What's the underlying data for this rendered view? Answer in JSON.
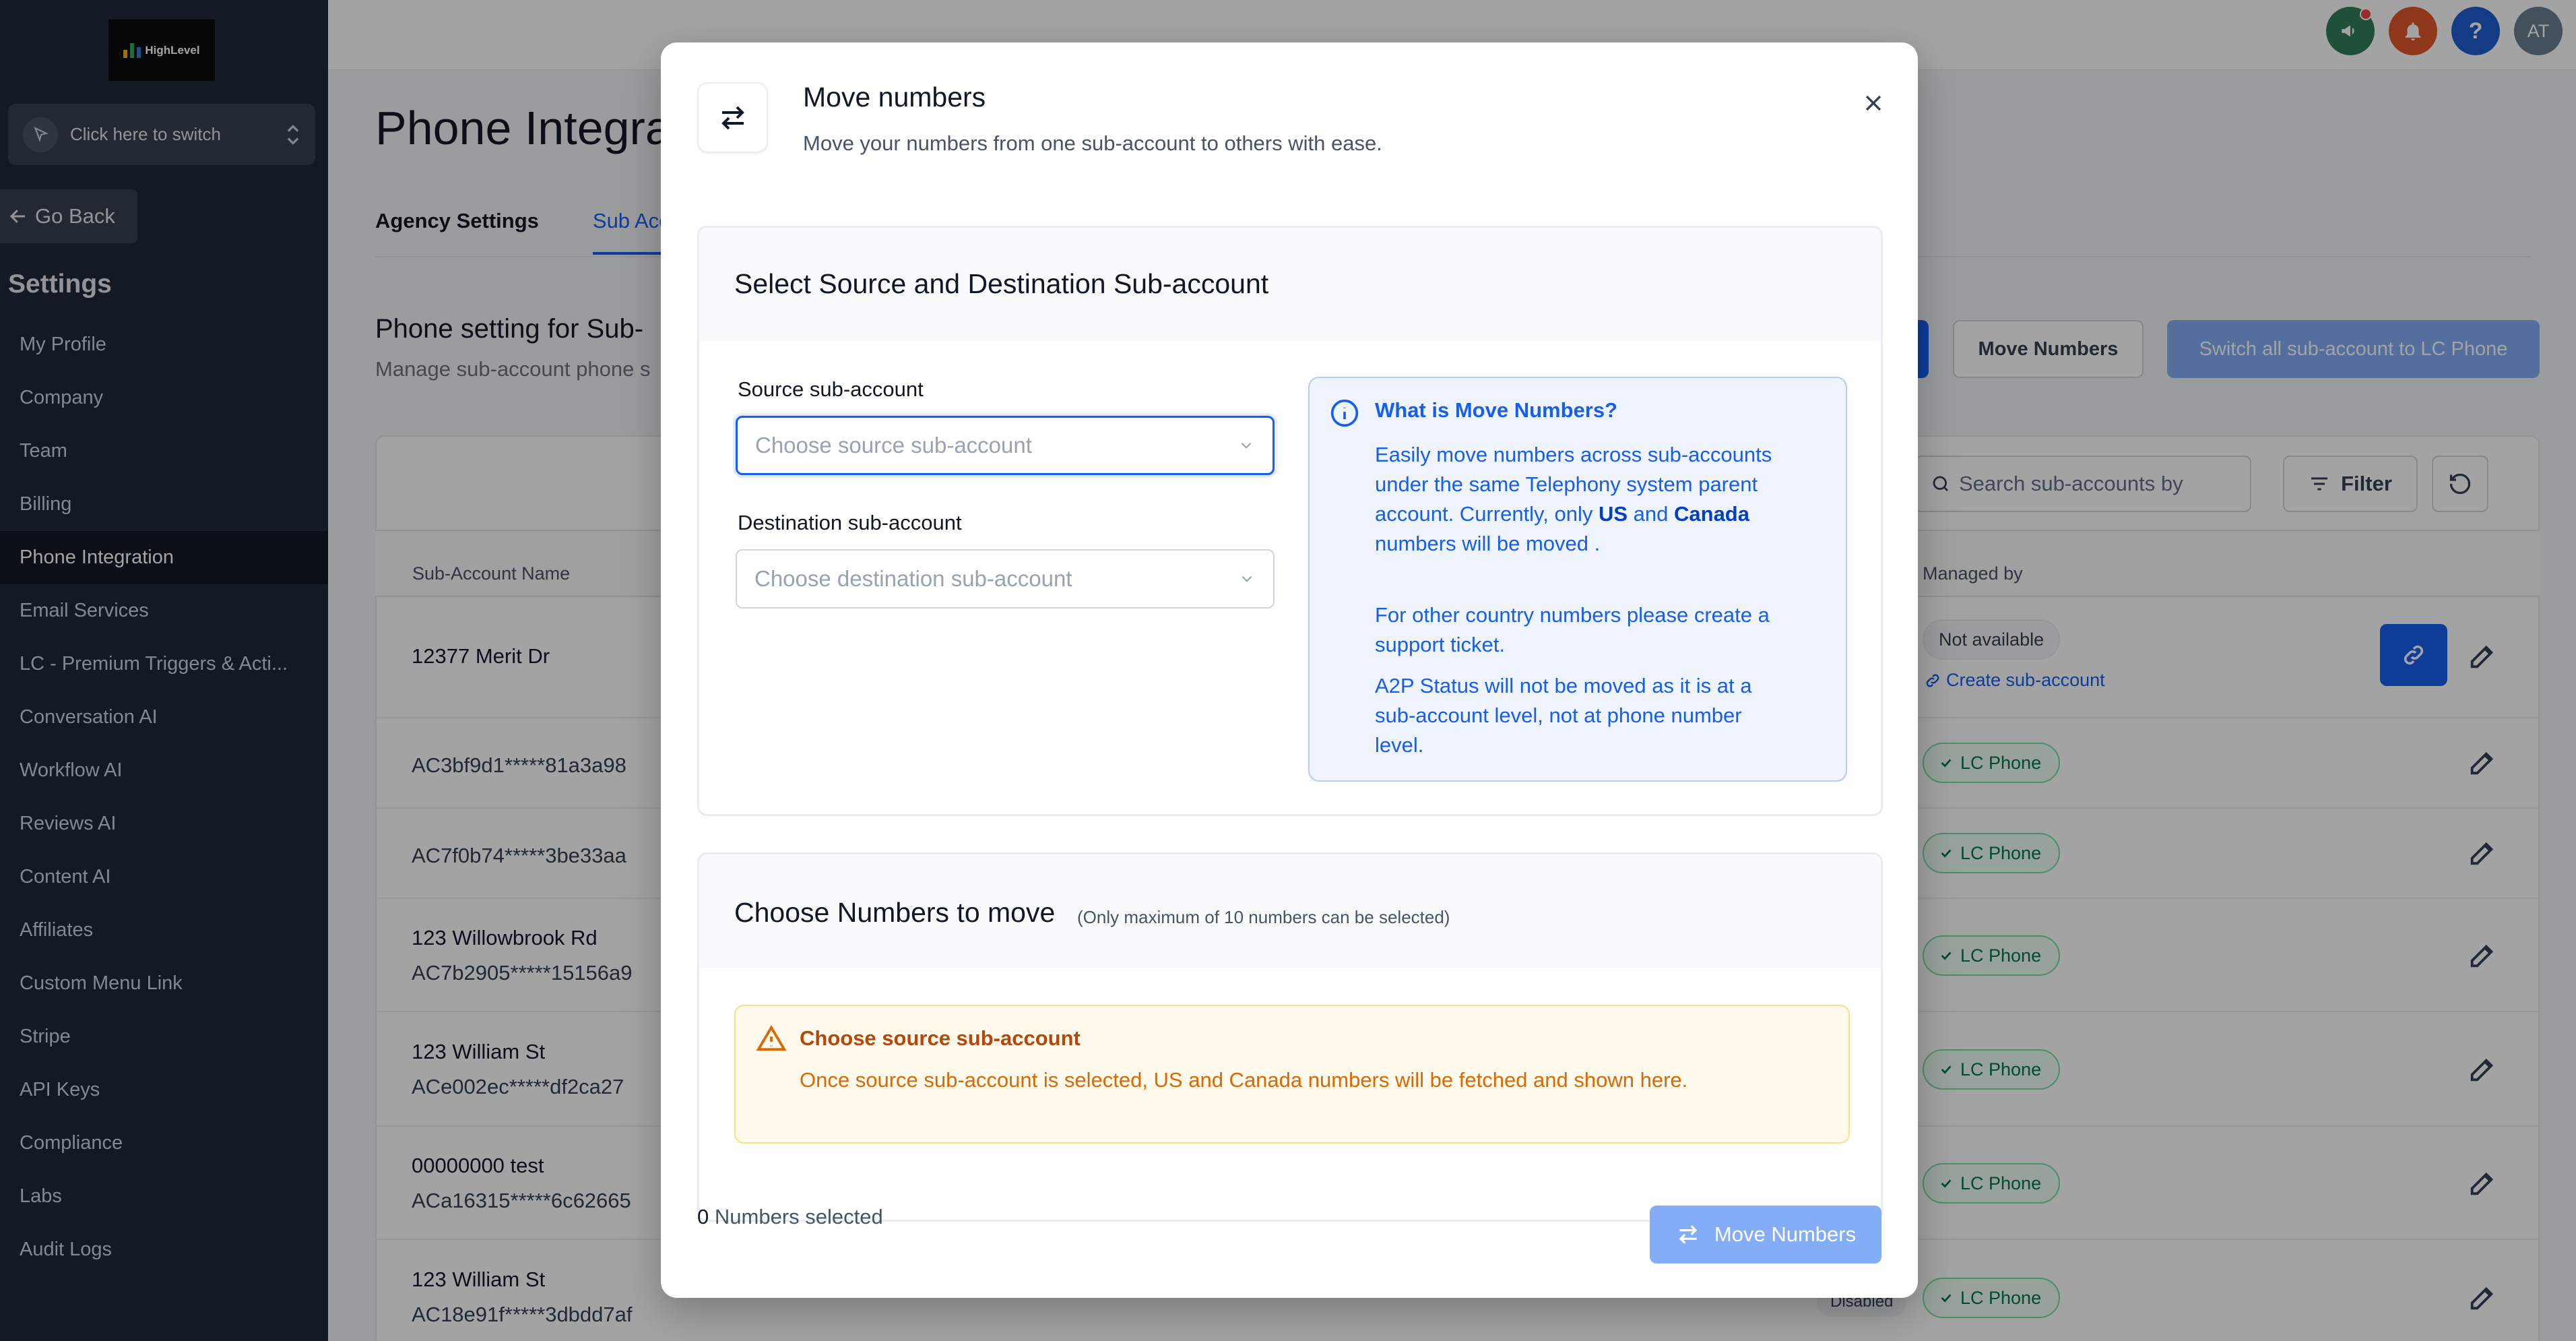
{
  "sidebar": {
    "logo_text": "HighLevel",
    "switcher_label": "Click here to switch",
    "go_back": "Go Back",
    "settings_title": "Settings",
    "items": [
      {
        "label": "My Profile"
      },
      {
        "label": "Company"
      },
      {
        "label": "Team"
      },
      {
        "label": "Billing"
      },
      {
        "label": "Phone Integration",
        "active": true
      },
      {
        "label": "Email Services"
      },
      {
        "label": "LC - Premium Triggers & Acti..."
      },
      {
        "label": "Conversation AI"
      },
      {
        "label": "Workflow AI"
      },
      {
        "label": "Reviews AI"
      },
      {
        "label": "Content AI"
      },
      {
        "label": "Affiliates"
      },
      {
        "label": "Custom Menu Link"
      },
      {
        "label": "Stripe"
      },
      {
        "label": "API Keys"
      },
      {
        "label": "Compliance"
      },
      {
        "label": "Labs"
      },
      {
        "label": "Audit Logs"
      }
    ]
  },
  "topbar": {
    "avatar_initials": "AT",
    "help_glyph": "?",
    "colors": {
      "announce": "#2f7d5b",
      "bell": "#e0562b",
      "help": "#1f5fd1",
      "avatar": "#6b7d8f"
    }
  },
  "page": {
    "title": "Phone Integra",
    "tabs": [
      "Agency Settings",
      "Sub Acc"
    ],
    "section_title": "Phone setting for Sub-",
    "section_sub": "Manage sub-account phone s",
    "move_numbers_btn": "Move Numbers",
    "switch_all_btn": "Switch all sub-account to LC Phone",
    "search_placeholder": "Search sub-accounts by",
    "filter_label": "Filter",
    "col_name": "Sub-Account Name",
    "col_managed": "Managed by",
    "rows": [
      {
        "name": "12377 Merit Dr",
        "sid": "",
        "managed": "Not available",
        "link": "Create sub-account"
      },
      {
        "name": "",
        "sid": "AC3bf9d1*****81a3a98",
        "managed": "LC Phone"
      },
      {
        "name": "",
        "sid": "AC7f0b74*****3be33aa",
        "managed": "LC Phone"
      },
      {
        "name": "123 Willowbrook Rd",
        "sid": "AC7b2905*****15156a9",
        "managed": "LC Phone"
      },
      {
        "name": "123 William St",
        "sid": "ACe002ec*****df2ca27",
        "managed": "LC Phone"
      },
      {
        "name": "00000000 test",
        "sid": "ACa16315*****6c62665",
        "managed": "LC Phone"
      },
      {
        "name": "123 William St",
        "sid": "AC18e91f*****3dbdd7af",
        "managed": "LC Phone",
        "status": "Disabled"
      }
    ]
  },
  "modal": {
    "title": "Move numbers",
    "subtitle": "Move your numbers from one sub-account to others with ease.",
    "section1_title": "Select Source and Destination Sub-account",
    "source_label": "Source sub-account",
    "source_placeholder": "Choose source sub-account",
    "dest_label": "Destination sub-account",
    "dest_placeholder": "Choose destination sub-account",
    "info": {
      "title": "What is Move Numbers?",
      "p1_a": "Easily move numbers across sub-accounts under the same Telephony system parent account. Currently, only ",
      "p1_us": "US",
      "p1_and": " and ",
      "p1_ca": "Canada",
      "p1_b": " numbers will be moved .",
      "p2": "For other country numbers please create a support ticket.",
      "p3": "A2P Status will not be moved as it is at a sub-account level, not at phone number level."
    },
    "section2_title": "Choose Numbers to move",
    "section2_note": "(Only maximum of 10 numbers can be selected)",
    "warning_title": "Choose source sub-account",
    "warning_text": "Once source sub-account is selected, US and Canada numbers will be fetched and shown here.",
    "selected_count": "0",
    "selected_label": "Numbers selected",
    "move_button": "Move Numbers"
  }
}
